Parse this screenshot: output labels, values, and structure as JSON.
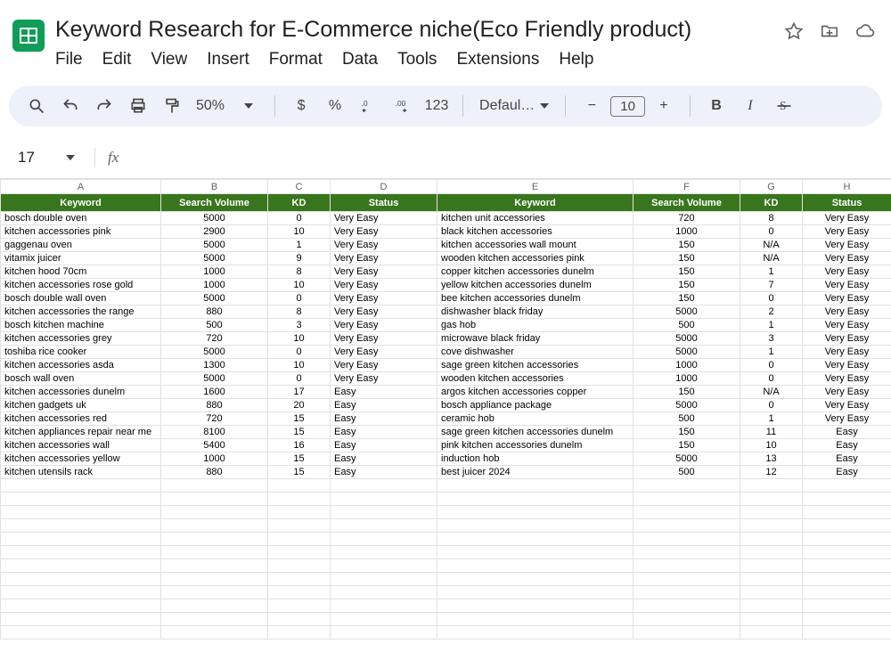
{
  "doc": {
    "title": "Keyword Research for E-Commerce niche(Eco Friendly product)"
  },
  "menus": [
    "File",
    "Edit",
    "View",
    "Insert",
    "Format",
    "Data",
    "Tools",
    "Extensions",
    "Help"
  ],
  "toolbar": {
    "zoom": "50%",
    "dollar": "$",
    "percent": "%",
    "number": "123",
    "font": "Defaul…",
    "minus": "−",
    "fontsize": "10",
    "plus": "+",
    "bold": "B",
    "italic": "I"
  },
  "namebox": "17",
  "fx": "fx",
  "columns": [
    "A",
    "B",
    "C",
    "D",
    "E",
    "F",
    "G",
    "H"
  ],
  "headers": [
    "Keyword",
    "Search Volume",
    "KD",
    "Status",
    "Keyword",
    "Search Volume",
    "KD",
    "Status"
  ],
  "rows": [
    [
      "bosch double oven",
      "5000",
      "0",
      "Very Easy",
      "kitchen unit accessories",
      "720",
      "8",
      "Very Easy"
    ],
    [
      "kitchen accessories pink",
      "2900",
      "10",
      "Very Easy",
      "black kitchen accessories",
      "1000",
      "0",
      "Very Easy"
    ],
    [
      "gaggenau oven",
      "5000",
      "1",
      "Very Easy",
      "kitchen accessories wall mount",
      "150",
      "N/A",
      "Very Easy"
    ],
    [
      "vitamix juicer",
      "5000",
      "9",
      "Very Easy",
      "wooden kitchen accessories pink",
      "150",
      "N/A",
      "Very Easy"
    ],
    [
      "kitchen hood 70cm",
      "1000",
      "8",
      "Very Easy",
      "copper kitchen accessories dunelm",
      "150",
      "1",
      "Very Easy"
    ],
    [
      "kitchen accessories rose gold",
      "1000",
      "10",
      "Very Easy",
      "yellow kitchen accessories dunelm",
      "150",
      "7",
      "Very Easy"
    ],
    [
      "bosch double wall oven",
      "5000",
      "0",
      "Very Easy",
      "bee kitchen accessories dunelm",
      "150",
      "0",
      "Very Easy"
    ],
    [
      "kitchen accessories the range",
      "880",
      "8",
      "Very Easy",
      "dishwasher black friday",
      "5000",
      "2",
      "Very Easy"
    ],
    [
      "bosch kitchen machine",
      "500",
      "3",
      "Very Easy",
      "gas hob",
      "500",
      "1",
      "Very Easy"
    ],
    [
      "kitchen accessories grey",
      "720",
      "10",
      "Very Easy",
      "microwave black friday",
      "5000",
      "3",
      "Very Easy"
    ],
    [
      "toshiba rice cooker",
      "5000",
      "0",
      "Very Easy",
      "cove dishwasher",
      "5000",
      "1",
      "Very Easy"
    ],
    [
      "kitchen accessories asda",
      "1300",
      "10",
      "Very Easy",
      "sage green kitchen accessories",
      "1000",
      "0",
      "Very Easy"
    ],
    [
      "bosch wall oven",
      "5000",
      "0",
      "Very Easy",
      "wooden kitchen accessories",
      "1000",
      "0",
      "Very Easy"
    ],
    [
      "kitchen accessories dunelm",
      "1600",
      "17",
      "Easy",
      "argos kitchen accessories copper",
      "150",
      "N/A",
      "Very Easy"
    ],
    [
      "kitchen gadgets uk",
      "880",
      "20",
      "Easy",
      "bosch appliance package",
      "5000",
      "0",
      "Very Easy"
    ],
    [
      "kitchen accessories red",
      "720",
      "15",
      "Easy",
      "ceramic hob",
      "500",
      "1",
      "Very Easy"
    ],
    [
      "kitchen appliances repair near me",
      "8100",
      "15",
      "Easy",
      "sage green kitchen accessories dunelm",
      "150",
      "11",
      "Easy"
    ],
    [
      "kitchen accessories wall",
      "5400",
      "16",
      "Easy",
      "pink kitchen accessories dunelm",
      "150",
      "10",
      "Easy"
    ],
    [
      "kitchen accessories yellow",
      "1000",
      "15",
      "Easy",
      "induction hob",
      "5000",
      "13",
      "Easy"
    ],
    [
      "kitchen utensils rack",
      "880",
      "15",
      "Easy",
      "best juicer 2024",
      "500",
      "12",
      "Easy"
    ]
  ],
  "empty_rows": 12
}
